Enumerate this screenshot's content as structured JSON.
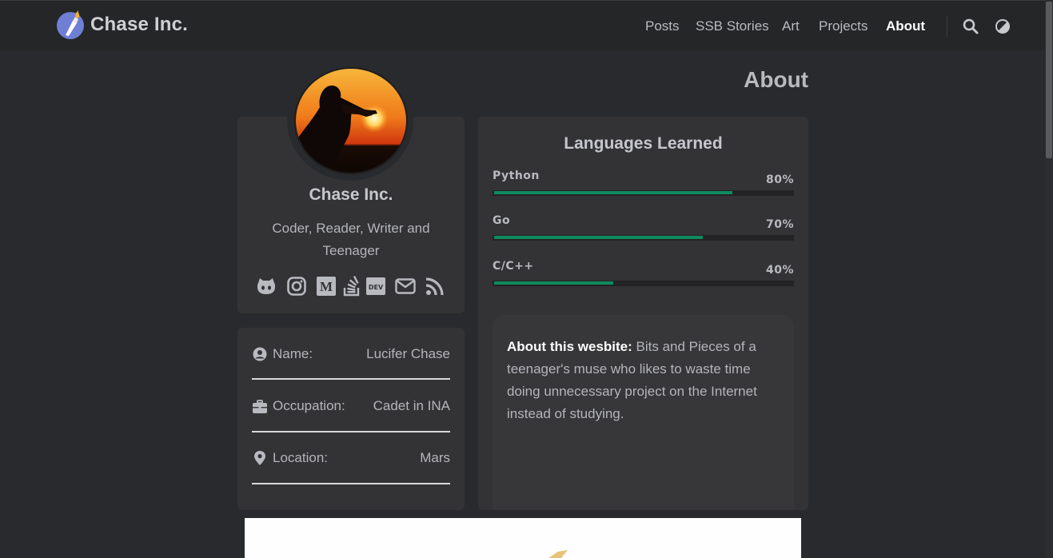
{
  "brand": {
    "name": "Chase Inc.",
    "logo_icon": "torch-logo-icon"
  },
  "nav": {
    "items": [
      {
        "label": "Posts",
        "active": false
      },
      {
        "label": "SSB Stories",
        "active": false
      },
      {
        "label": "Art",
        "active": false
      },
      {
        "label": "Projects",
        "active": false
      },
      {
        "label": "About",
        "active": true
      }
    ],
    "search_icon": "search-icon",
    "theme_icon": "theme-toggle-icon"
  },
  "page": {
    "title": "About"
  },
  "profile": {
    "name": "Chase Inc.",
    "tagline": "Coder, Reader, Writer and Teenager",
    "avatar_icon": "sunset-silhouette-avatar",
    "socials": [
      "github-icon",
      "instagram-icon",
      "medium-icon",
      "stackoverflow-icon",
      "dev-icon",
      "email-icon",
      "rss-icon"
    ]
  },
  "info": [
    {
      "icon": "user-circle-icon",
      "label": "Name:",
      "value": "Lucifer Chase"
    },
    {
      "icon": "briefcase-icon",
      "label": "Occupation:",
      "value": "Cadet in INA"
    },
    {
      "icon": "location-pin-icon",
      "label": "Location:",
      "value": "Mars"
    }
  ],
  "languages": {
    "title": "Languages Learned",
    "items": [
      {
        "name": "Python",
        "percent_label": "80%",
        "percent": 80
      },
      {
        "name": "Go",
        "percent_label": "70%",
        "percent": 70
      },
      {
        "name": "C/C++",
        "percent_label": "40%",
        "percent": 40
      }
    ]
  },
  "about_site": {
    "heading": "About this wesbite:",
    "body": "Bits and Pieces of a teenager's muse who likes to waste time doing unnecessary project on the Internet instead of studying."
  },
  "colors": {
    "background": "#292a2d",
    "header": "#252627",
    "card": "#333335",
    "progress": "#0f8a5f",
    "logo_circle": "#6f7fd6"
  }
}
